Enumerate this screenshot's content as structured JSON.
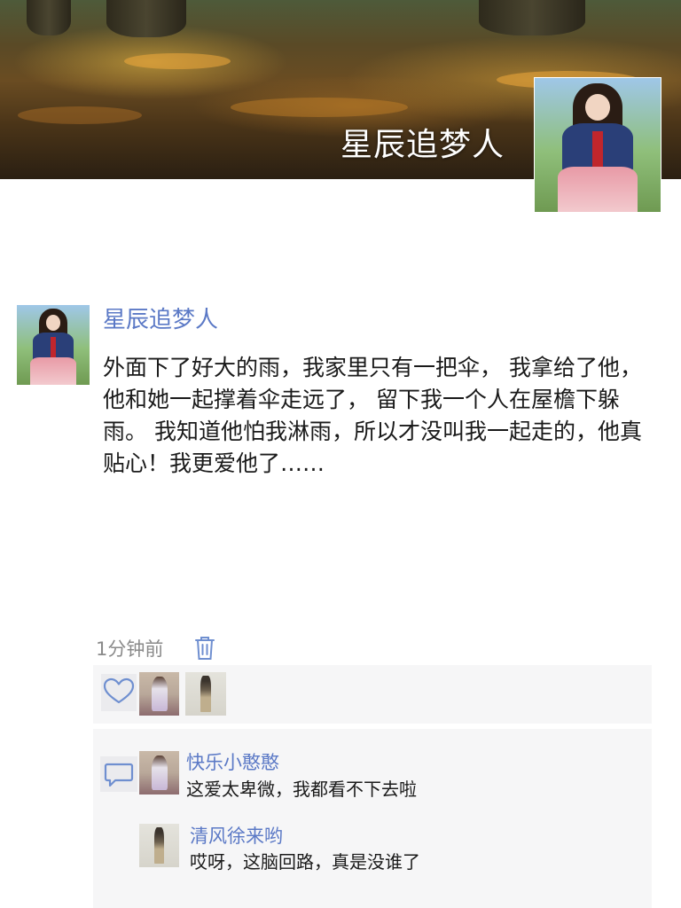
{
  "cover": {
    "title": "星辰追梦人"
  },
  "post": {
    "author": "星辰追梦人",
    "text": "外面下了好大的雨，我家里只有一把伞， 我拿给了他，他和她一起撑着伞走远了， 留下我一个人在屋檐下躲雨。 我知道他怕我淋雨，所以才没叫我一起走的，他真贴心！我更爱他了……",
    "time": "1分钟前"
  },
  "likes": {
    "users": [
      "avatar-1",
      "avatar-2"
    ]
  },
  "comments": [
    {
      "author": "快乐小憨憨",
      "text": "这爱太卑微，我都看不下去啦"
    },
    {
      "author": "清风徐来哟",
      "text": "哎呀，这脑回路，真是没谁了"
    }
  ],
  "colors": {
    "link": "#5b79c6",
    "panel": "#f6f6f7",
    "icon": "#6f8fd0"
  }
}
